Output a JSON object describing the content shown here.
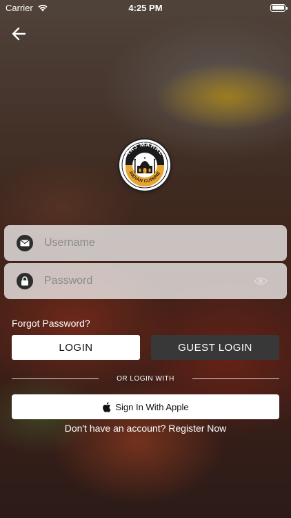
{
  "status_bar": {
    "carrier": "Carrier",
    "time": "4:25 PM"
  },
  "logo": {
    "top_text": "TAJ MAHAL",
    "bottom_text": "INDIAN CUISINE"
  },
  "form": {
    "username_placeholder": "Username",
    "username_value": "",
    "password_placeholder": "Password",
    "password_value": ""
  },
  "links": {
    "forgot_password": "Forgot Password?",
    "register": "Don't have an account? Register Now"
  },
  "buttons": {
    "login": "LOGIN",
    "guest_login": "GUEST LOGIN",
    "apple": "Sign In With Apple"
  },
  "divider_text": "OR LOGIN WITH",
  "icons": {
    "back": "arrow-left-icon",
    "username": "envelope-icon",
    "password": "lock-icon",
    "visibility": "eye-icon",
    "apple": "apple-logo-icon"
  },
  "colors": {
    "guest_button": "#383838",
    "field_background": "rgba(255,255,255,0.72)",
    "logo_accent": "#e8a52f"
  }
}
